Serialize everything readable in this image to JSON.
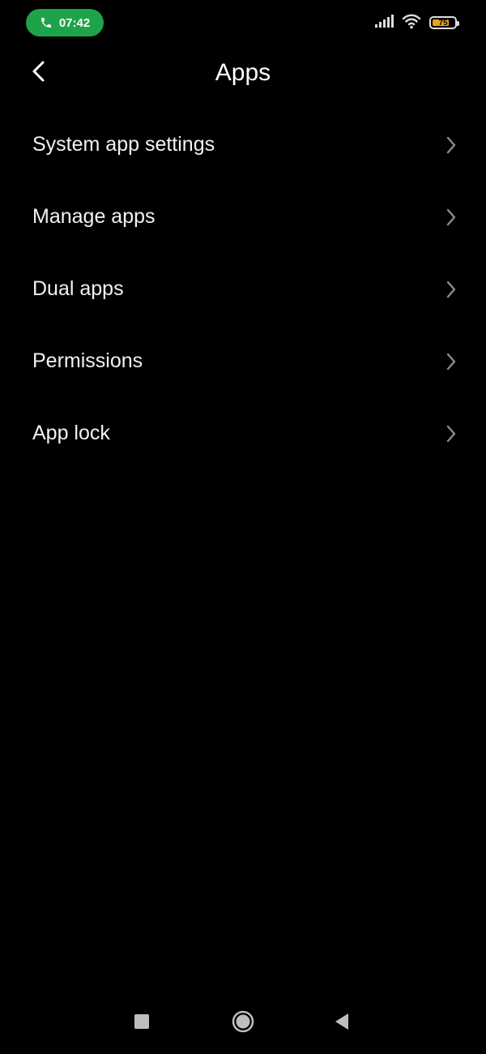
{
  "status_bar": {
    "time": "07:42",
    "battery_level": "75",
    "call_pill_color": "#1fa34a",
    "battery_color": "#e8a21b",
    "icons": [
      "phone-icon",
      "signal-icon",
      "wifi-icon",
      "battery-icon"
    ]
  },
  "header": {
    "title": "Apps",
    "back_icon": "chevron-left-icon"
  },
  "menu": {
    "items": [
      {
        "label": "System app settings"
      },
      {
        "label": "Manage apps"
      },
      {
        "label": "Dual apps"
      },
      {
        "label": "Permissions"
      },
      {
        "label": "App lock"
      }
    ],
    "chevron_icon": "chevron-right-icon"
  },
  "nav_bar": {
    "buttons": [
      "recents-icon",
      "home-icon",
      "back-icon"
    ]
  }
}
